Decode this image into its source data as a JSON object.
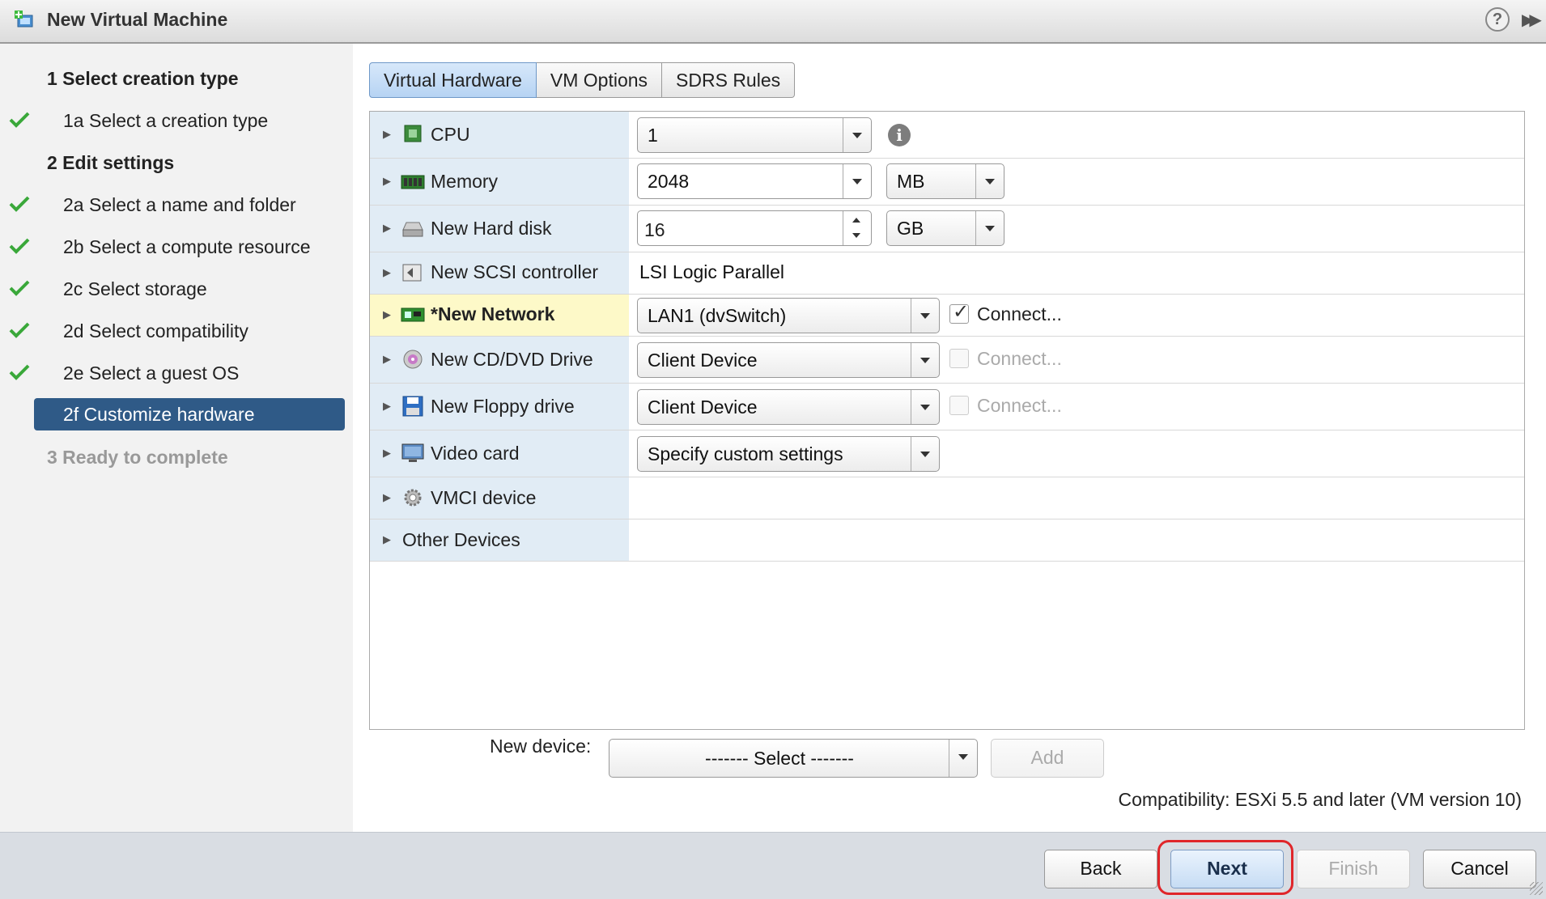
{
  "window": {
    "title": "New Virtual Machine"
  },
  "steps": [
    {
      "label": "1  Select creation type",
      "kind": "header",
      "checked": false
    },
    {
      "label": "1a  Select a creation type",
      "kind": "sub",
      "checked": true
    },
    {
      "label": "2  Edit settings",
      "kind": "header",
      "checked": false
    },
    {
      "label": "2a  Select a name and folder",
      "kind": "sub",
      "checked": true
    },
    {
      "label": "2b  Select a compute resource",
      "kind": "sub",
      "checked": true
    },
    {
      "label": "2c  Select storage",
      "kind": "sub",
      "checked": true
    },
    {
      "label": "2d  Select compatibility",
      "kind": "sub",
      "checked": true
    },
    {
      "label": "2e  Select a guest OS",
      "kind": "sub",
      "checked": true
    },
    {
      "label": "2f  Customize hardware",
      "kind": "sub",
      "selected": true
    },
    {
      "label": "3  Ready to complete",
      "kind": "header",
      "disabled": true
    }
  ],
  "tabs": [
    "Virtual Hardware",
    "VM Options",
    "SDRS Rules"
  ],
  "hardware": {
    "cpu": {
      "label": "CPU",
      "value": "1"
    },
    "memory": {
      "label": "Memory",
      "value": "2048",
      "unit": "MB"
    },
    "hard_disk": {
      "label": "New Hard disk",
      "value": "16",
      "unit": "GB"
    },
    "scsi": {
      "label": "New SCSI controller",
      "value": "LSI Logic Parallel"
    },
    "network": {
      "label": "*New Network",
      "value": "LAN1 (dvSwitch)",
      "connect_label": "Connect...",
      "connected": true
    },
    "cddvd": {
      "label": "New CD/DVD Drive",
      "value": "Client Device",
      "connect_label": "Connect...",
      "connected": false
    },
    "floppy": {
      "label": "New Floppy drive",
      "value": "Client Device",
      "connect_label": "Connect...",
      "connected": false
    },
    "video": {
      "label": "Video card",
      "value": "Specify custom settings"
    },
    "vmci": {
      "label": "VMCI device"
    },
    "other": {
      "label": "Other Devices"
    }
  },
  "new_device": {
    "label": "New device:",
    "select_value": "------- Select -------",
    "add_label": "Add"
  },
  "compatibility": "Compatibility: ESXi 5.5 and later (VM version 10)",
  "buttons": {
    "back": "Back",
    "next": "Next",
    "finish": "Finish",
    "cancel": "Cancel"
  },
  "colors": {
    "selected_step": "#2f5a87",
    "highlight_row": "#fdf9c8",
    "next_outline": "#e0262a",
    "check": "#3aa83a"
  }
}
